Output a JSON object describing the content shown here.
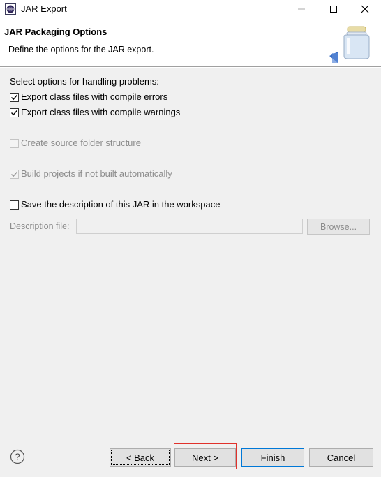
{
  "window": {
    "title": "JAR Export",
    "icon": "eclipse-icon",
    "controls": [
      "minimize-icon",
      "maximize-icon",
      "close-icon"
    ]
  },
  "header": {
    "title": "JAR Packaging Options",
    "description": "Define the options for the JAR export."
  },
  "problems": {
    "heading": "Select options for handling problems:",
    "compile_errors": {
      "label": "Export class files with compile errors",
      "checked": true,
      "enabled": true
    },
    "compile_warnings": {
      "label": "Export class files with compile warnings",
      "checked": true,
      "enabled": true
    }
  },
  "source_folder": {
    "label": "Create source folder structure",
    "checked": false,
    "enabled": false
  },
  "build_projects": {
    "label": "Build projects if not built automatically",
    "checked": true,
    "enabled": false
  },
  "save_description": {
    "label": "Save the description of this JAR in the workspace",
    "checked": false,
    "enabled": true
  },
  "description_file": {
    "label": "Description file:",
    "value": "",
    "enabled": false
  },
  "browse_label": "Browse...",
  "footer": {
    "help_icon": "help-icon",
    "back_label": "< Back",
    "next_label": "Next >",
    "finish_label": "Finish",
    "cancel_label": "Cancel"
  },
  "colors": {
    "highlight_box": "#e0312b",
    "default_button_border": "#0078d7",
    "content_background": "#f0f0f0"
  }
}
